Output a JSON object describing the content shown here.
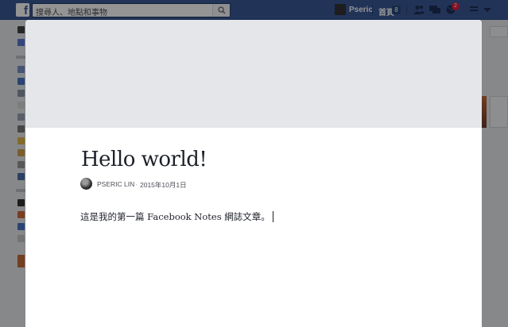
{
  "topbar": {
    "logo": "f",
    "search_placeholder": "搜尋人、地點和事物",
    "user_name": "Pseric",
    "home_label": "首頁",
    "home_count": "8",
    "notification_count": "2"
  },
  "note": {
    "title": "Hello world!",
    "author": "PSERIC LIN",
    "separator": "·",
    "date": "2015年10月1日",
    "body": "這是我的第一篇 Facebook Notes 網誌文章。"
  },
  "colors": {
    "brand": "#3b5998",
    "badge": "#e41e3f"
  }
}
